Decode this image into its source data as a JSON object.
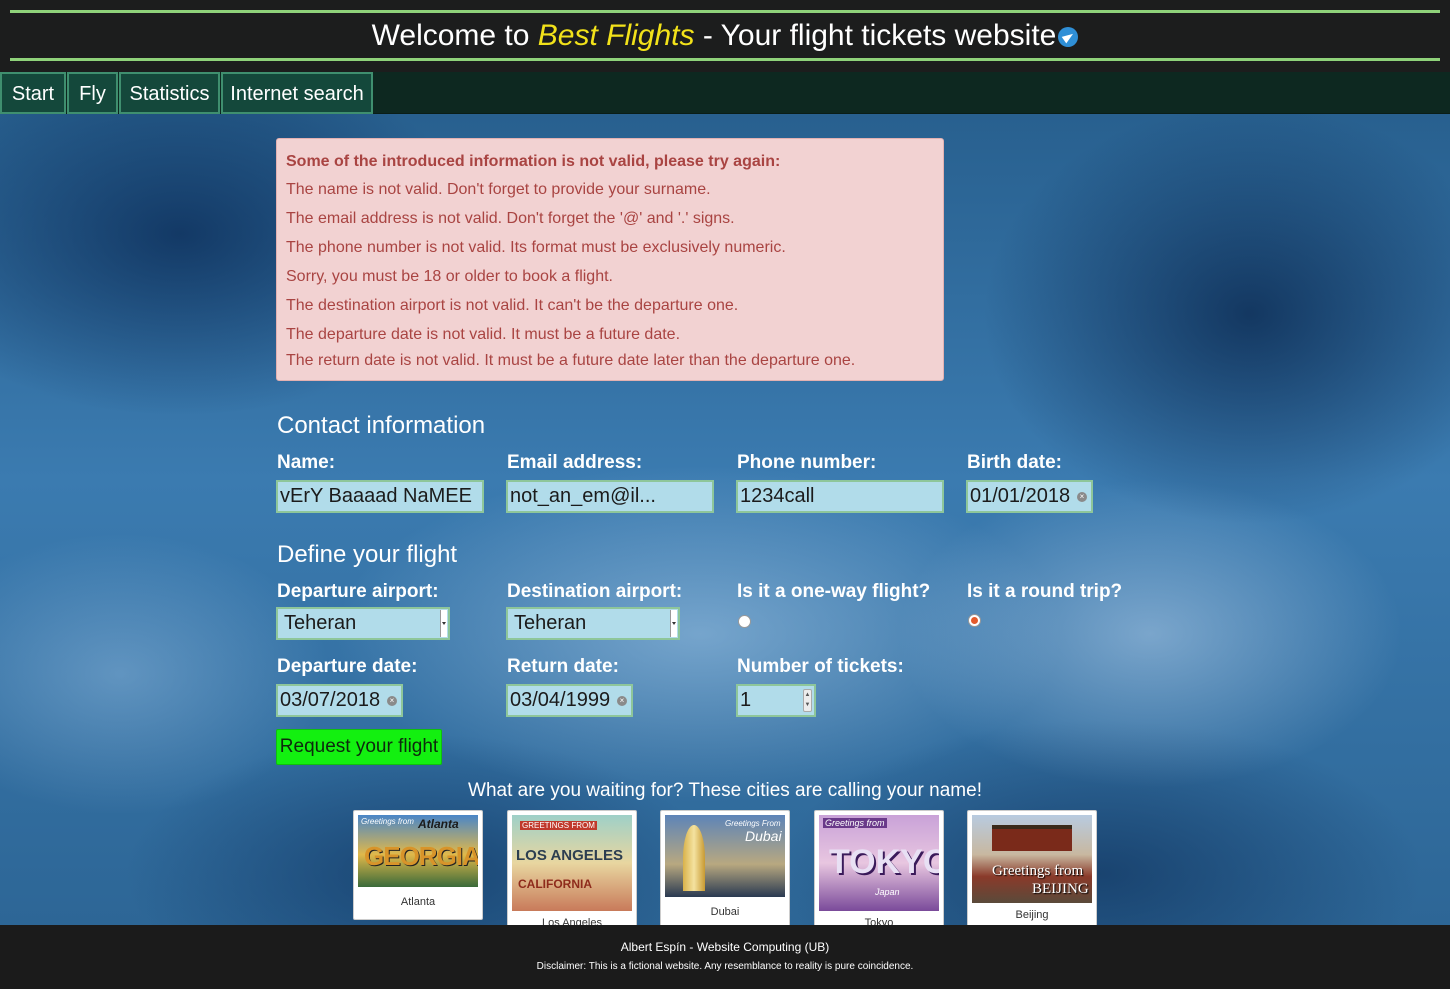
{
  "header": {
    "title_prefix": "Welcome to ",
    "brand": "Best Flights",
    "title_suffix": " - Your flight tickets website",
    "logo_icon": "plane-icon"
  },
  "nav": {
    "items": [
      {
        "label": "Start"
      },
      {
        "label": "Fly"
      },
      {
        "label": "Statistics"
      },
      {
        "label": "Internet search"
      }
    ]
  },
  "errors": {
    "heading": "Some of the introduced information is not valid, please try again:",
    "messages": [
      "The name is not valid. Don't forget to provide your surname.",
      "The email address is not valid. Don't forget the '@' and '.' signs.",
      "The phone number is not valid. Its format must be exclusively numeric.",
      "Sorry, you must be 18 or older to book a flight.",
      "The destination airport is not valid. It can't be the departure one.",
      "The departure date is not valid. It must be a future date.",
      "The return date is not valid. It must be a future date later than the departure one."
    ]
  },
  "contact": {
    "title": "Contact information",
    "name_label": "Name:",
    "name_value": "vErY Baaaad NaMEE",
    "email_label": "Email address:",
    "email_value": "not_an_em@il...",
    "phone_label": "Phone number:",
    "phone_value": "1234call",
    "birth_label": "Birth date:",
    "birth_value": "01/01/2018"
  },
  "flight": {
    "title": "Define your flight",
    "departure_airport_label": "Departure airport:",
    "departure_airport_value": "Teheran",
    "destination_airport_label": "Destination airport:",
    "destination_airport_value": "Teheran",
    "one_way_label": "Is it a one-way flight?",
    "one_way_checked": false,
    "round_trip_label": "Is it a round trip?",
    "round_trip_checked": true,
    "departure_date_label": "Departure date:",
    "departure_date_value": "03/07/2018",
    "return_date_label": "Return date:",
    "return_date_value": "03/04/1999",
    "tickets_label": "Number of tickets:",
    "tickets_value": "1",
    "submit_label": "Request your flight"
  },
  "promo": {
    "text": "What are you waiting for? These cities are calling your name!",
    "cities": [
      {
        "caption": "Atlanta",
        "card_text_1": "Greetings from",
        "card_text_2": "Atlanta",
        "card_text_3": "GEORGIA"
      },
      {
        "caption": "Los Angeles",
        "card_text_1": "GREETINGS FROM",
        "card_text_2": "LOS ANGELES",
        "card_text_3": "CALIFORNIA"
      },
      {
        "caption": "Dubai",
        "card_text_1": "Greetings From",
        "card_text_2": "Dubai"
      },
      {
        "caption": "Tokyo",
        "card_text_1": "Greetings from",
        "card_text_2": "TOKYO",
        "card_text_3": "Japan"
      },
      {
        "caption": "Beijing",
        "card_text_1": "Greetings from",
        "card_text_2": "BEIJING"
      }
    ]
  },
  "footer": {
    "credit": "Albert Espín - Website Computing (UB)",
    "disclaimer": "Disclaimer: This is a fictional website. Any resemblance to reality is pure coincidence."
  },
  "colors": {
    "header_bg": "#1c1d1d",
    "header_rule": "#8fd27a",
    "brand": "#f2e21a",
    "nav_item_bg": "#14483b",
    "error_text": "#a94442",
    "error_bg": "#f2d2d2",
    "field_bg": "#b1dcea",
    "submit_bg": "#13f010"
  }
}
